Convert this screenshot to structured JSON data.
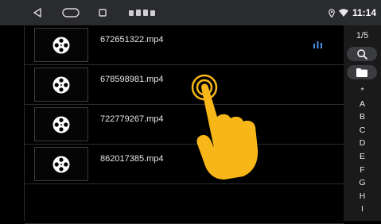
{
  "statusbar": {
    "time": "11:14",
    "icons": [
      "location-icon",
      "wifi-icon"
    ],
    "nav": [
      "back-icon",
      "home-icon",
      "recents-icon"
    ]
  },
  "files": [
    {
      "name": "672651322.mp4",
      "playing": true
    },
    {
      "name": "678598981.mp4",
      "playing": false
    },
    {
      "name": "722779267.mp4",
      "playing": false
    },
    {
      "name": "862017385.mp4",
      "playing": false
    }
  ],
  "sidebar": {
    "page": "1/5",
    "index_letters": [
      "*",
      "A",
      "B",
      "C",
      "D",
      "E",
      "F",
      "G",
      "H",
      "I"
    ]
  },
  "colors": {
    "accent": "#4a8ee8",
    "touch_hand": "#f7b718",
    "status_bg": "#2a2b2f"
  }
}
